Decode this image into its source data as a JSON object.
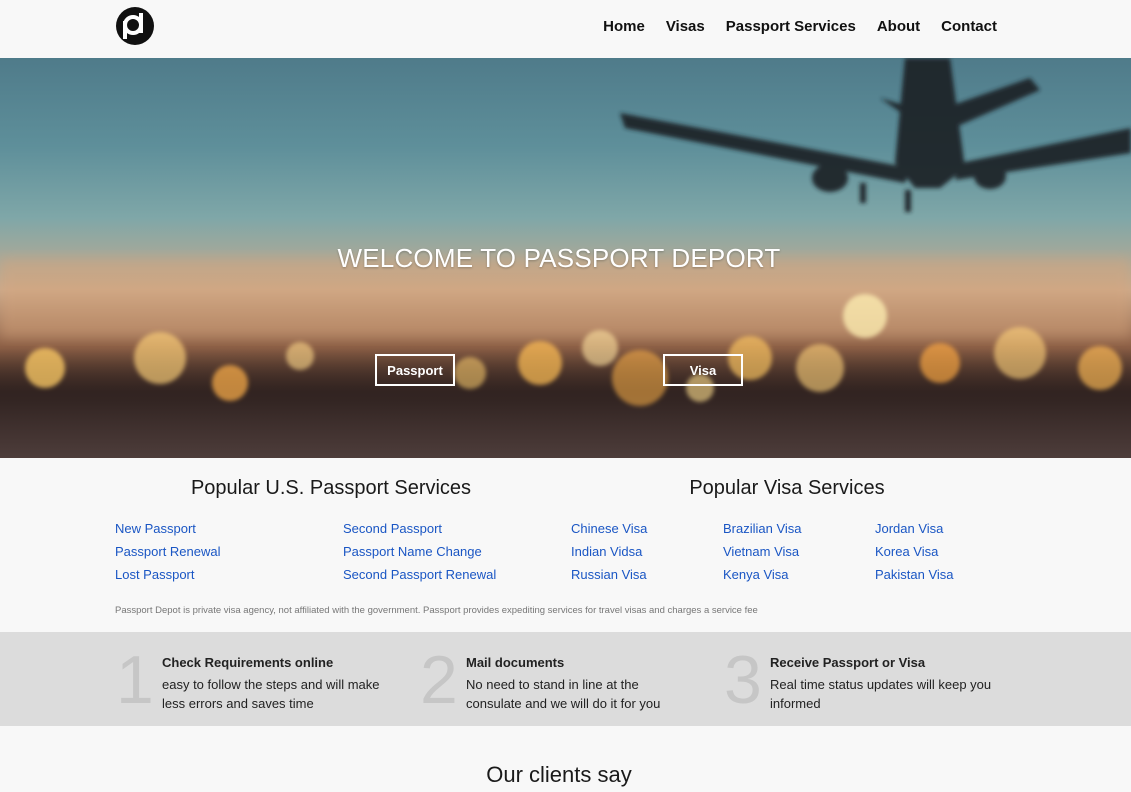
{
  "header": {
    "logo_icon": "passport-depot-logo",
    "nav": [
      "Home",
      "Visas",
      "Passport Services",
      "About",
      "Contact"
    ]
  },
  "hero": {
    "title": "WELCOME TO PASSPORT DEPORT",
    "buttons": {
      "passport": "Passport",
      "visa": "Visa"
    },
    "background": "blurred-airport-airplane-photo"
  },
  "services": {
    "passport_title": "Popular U.S. Passport Services",
    "visa_title": "Popular Visa Services",
    "passport_col1": [
      "New Passport",
      "Passport Renewal",
      "Lost Passport"
    ],
    "passport_col2": [
      "Second Passport",
      "Passport Name Change",
      "Second Passport Renewal"
    ],
    "visa_col1": [
      "Chinese Visa",
      "Indian Vidsa",
      "Russian Visa"
    ],
    "visa_col2": [
      "Brazilian Visa",
      "Vietnam Visa",
      "Kenya Visa"
    ],
    "visa_col3": [
      "Jordan Visa",
      "Korea Visa",
      "Pakistan Visa"
    ],
    "disclaimer": "Passport Depot is private visa agency, not affiliated with the government. Passport provides expediting services for travel visas and charges a service fee"
  },
  "steps": [
    {
      "num": "1",
      "title": "Check Requirements online",
      "desc": "easy to follow the steps and will make less errors and saves time"
    },
    {
      "num": "2",
      "title": "Mail documents",
      "desc": "No need to stand in line at the consulate and we will do it for you"
    },
    {
      "num": "3",
      "title": "Receive Passport or Visa",
      "desc": "Real time status updates will keep you informed"
    }
  ],
  "clients": {
    "title": "Our clients say"
  },
  "colors": {
    "link": "#1a56c4",
    "steps_bg": "#dcdcdc",
    "page_bg": "#f8f8f8"
  }
}
